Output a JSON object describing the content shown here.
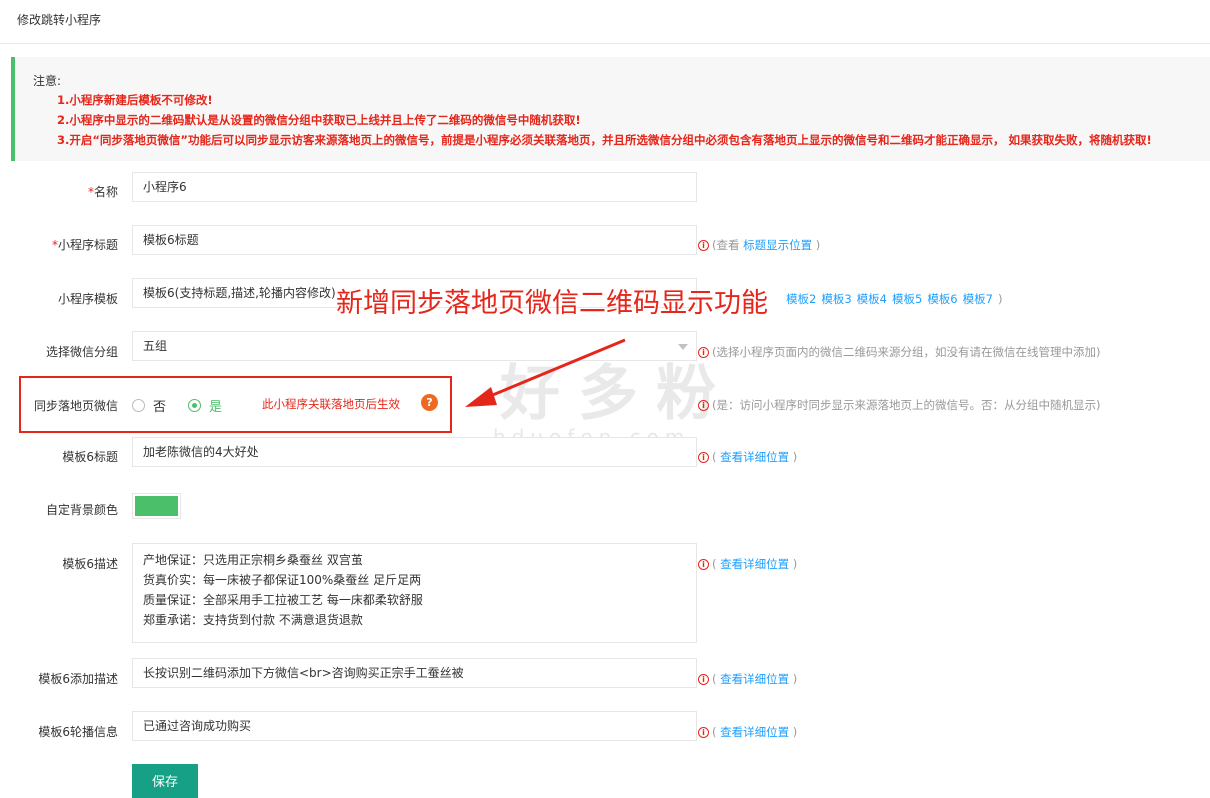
{
  "header": {
    "title": "修改跳转小程序"
  },
  "notice": {
    "head": "注意:",
    "lines": [
      "1.小程序新建后模板不可修改!",
      "2.小程序中显示的二维码默认是从设置的微信分组中获取已上线并且上传了二维码的微信号中随机获取!",
      "3.开启“同步落地页微信”功能后可以同步显示访客来源落地页上的微信号，前提是小程序必须关联落地页，并且所选微信分组中必须包含有落地页上显示的微信号和二维码才能正确显示，  如果获取失败，将随机获取!"
    ]
  },
  "form": {
    "name": {
      "label": "名称",
      "required": "*",
      "value": "小程序6"
    },
    "title": {
      "label": "小程序标题",
      "required": "*",
      "value": "模板6标题",
      "hint_prefix": "(查看 ",
      "hint_link": "标题显示位置",
      "hint_suffix": " )"
    },
    "template": {
      "label": "小程序模板",
      "value": "模板6(支持标题,描述,轮播内容修改)",
      "links": [
        "模板2",
        "模板3",
        "模板4",
        "模板5",
        "模板6",
        "模板7"
      ],
      "close": ")"
    },
    "wechat_group": {
      "label": "选择微信分组",
      "value": "五组",
      "hint": "(选择小程序页面内的微信二维码来源分组，如没有请在微信在线管理中添加)"
    },
    "sync": {
      "label": "同步落地页微信",
      "options": [
        "否",
        "是"
      ],
      "selected": "是",
      "note": "此小程序关联落地页后生效",
      "help": "?",
      "hint": "(是：访问小程序时同步显示来源落地页上的微信号。否：从分组中随机显示)"
    },
    "tpl_title": {
      "label": "模板6标题",
      "value": "加老陈微信的4大好处",
      "hint_link": "查看详细位置"
    },
    "bg_color": {
      "label": "自定背景颜色",
      "color": "#4cbf6a"
    },
    "tpl_desc": {
      "label": "模板6描述",
      "value": "产地保证：只选用正宗桐乡桑蚕丝 双宫茧\n货真价实：每一床被子都保证100%桑蚕丝 足斤足两\n质量保证：全部采用手工拉被工艺 每一床都柔软舒服\n郑重承诺：支持货到付款 不满意退货退款",
      "hint_link": "查看详细位置"
    },
    "tpl_add_desc": {
      "label": "模板6添加描述",
      "value": "长按识别二维码添加下方微信<br>咨询购买正宗手工蚕丝被",
      "hint_link": "查看详细位置"
    },
    "tpl_carousel": {
      "label": "模板6轮播信息",
      "value": "已通过咨询成功购买",
      "hint_link": "查看详细位置"
    },
    "save_label": "保存",
    "hint_open": "( ",
    "hint_close": " )",
    "info_glyph": "i"
  },
  "annotation": {
    "text": "新增同步落地页微信二维码显示功能"
  },
  "watermark": {
    "text": "好多粉",
    "sub": "hduofen.com"
  },
  "colors": {
    "accent": "#4cbf6a",
    "danger": "#e5261b",
    "link": "#1e9fff",
    "button": "#16a085"
  }
}
